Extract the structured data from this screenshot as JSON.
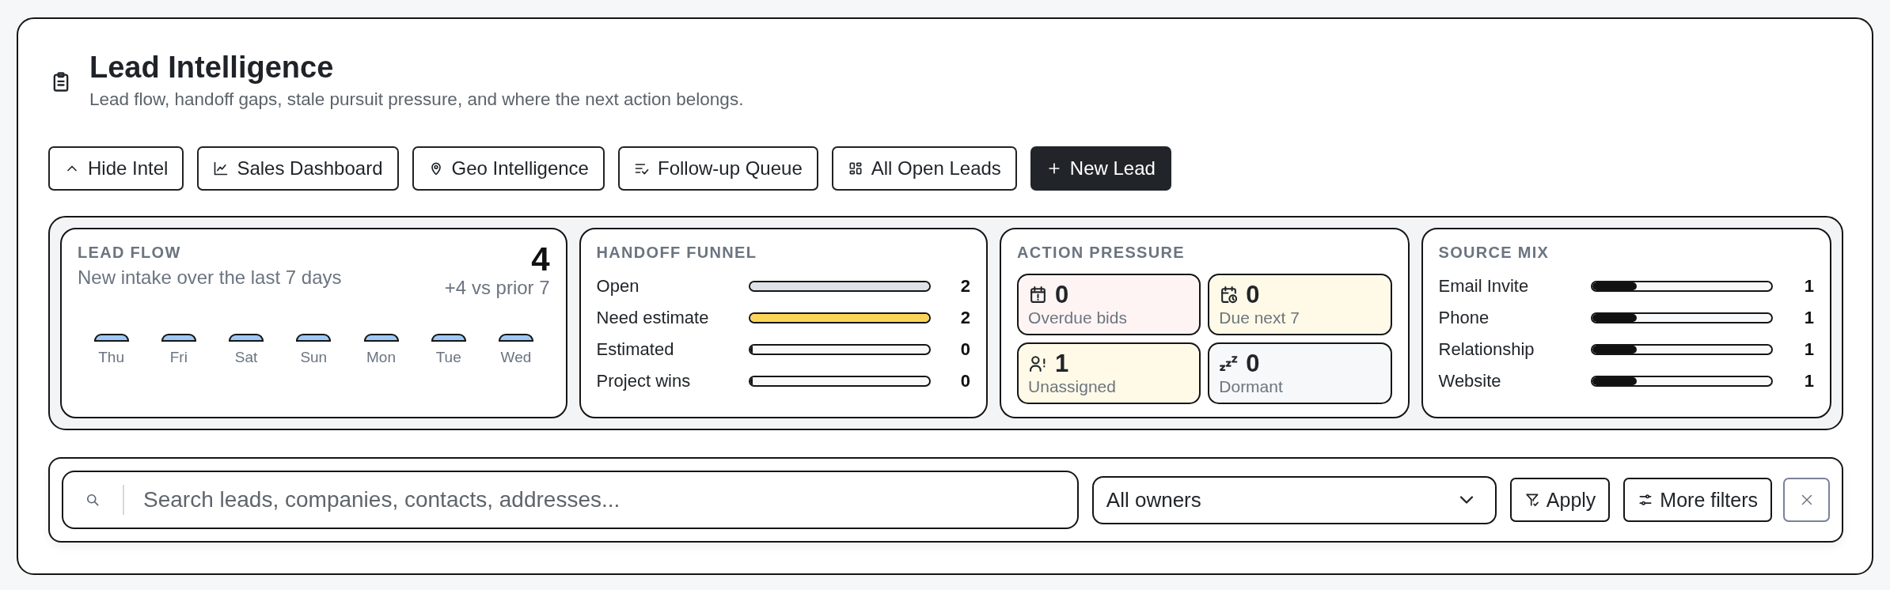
{
  "header": {
    "title": "Lead Intelligence",
    "subtitle": "Lead flow, handoff gaps, stale pursuit pressure, and where the next action belongs."
  },
  "actions": [
    {
      "label": "Hide Intel",
      "kind": "outline"
    },
    {
      "label": "Sales Dashboard",
      "kind": "outline"
    },
    {
      "label": "Geo Intelligence",
      "kind": "outline"
    },
    {
      "label": "Follow-up Queue",
      "kind": "outline"
    },
    {
      "label": "All Open Leads",
      "kind": "outline"
    },
    {
      "label": "New Lead",
      "kind": "primary"
    }
  ],
  "lead_flow": {
    "title": "LEAD FLOW",
    "subtitle": "New intake over the last 7 days",
    "total": "4",
    "comparison": "+4 vs prior 7",
    "days": [
      "Thu",
      "Fri",
      "Sat",
      "Sun",
      "Mon",
      "Tue",
      "Wed"
    ]
  },
  "handoff_funnel": {
    "title": "HANDOFF FUNNEL",
    "stages": [
      {
        "label": "Open",
        "level": 1,
        "color": "#dee2e6",
        "count": "2"
      },
      {
        "label": "Need estimate",
        "level": 1,
        "color": "#fbd55a",
        "count": "2"
      },
      {
        "label": "Estimated",
        "level": 0,
        "count": "0"
      },
      {
        "label": "Project wins",
        "level": 0,
        "count": "0"
      }
    ]
  },
  "action_pressure": {
    "title": "ACTION PRESSURE",
    "tiles": [
      {
        "value": "0",
        "label": "Overdue bids",
        "color": "#fff4f4"
      },
      {
        "value": "0",
        "label": "Due next 7",
        "color": "#fffae8"
      },
      {
        "value": "1",
        "label": "Unassigned",
        "color": "#fffae8"
      },
      {
        "value": "0",
        "label": "Dormant",
        "color": "#f7f8fa"
      }
    ]
  },
  "source_mix": {
    "title": "SOURCE MIX",
    "sources": [
      {
        "label": "Email Invite",
        "level": 0.25,
        "count": "1"
      },
      {
        "label": "Phone",
        "level": 0.25,
        "count": "1"
      },
      {
        "label": "Relationship",
        "level": 0.25,
        "count": "1"
      },
      {
        "label": "Website",
        "level": 0.25,
        "count": "1"
      }
    ]
  },
  "filters": {
    "search": {
      "placeholder": "Search leads, companies, contacts, addresses..."
    },
    "owner": {
      "value": "All owners"
    },
    "buttons": [
      {
        "label": "Apply"
      },
      {
        "label": "More filters"
      }
    ]
  }
}
